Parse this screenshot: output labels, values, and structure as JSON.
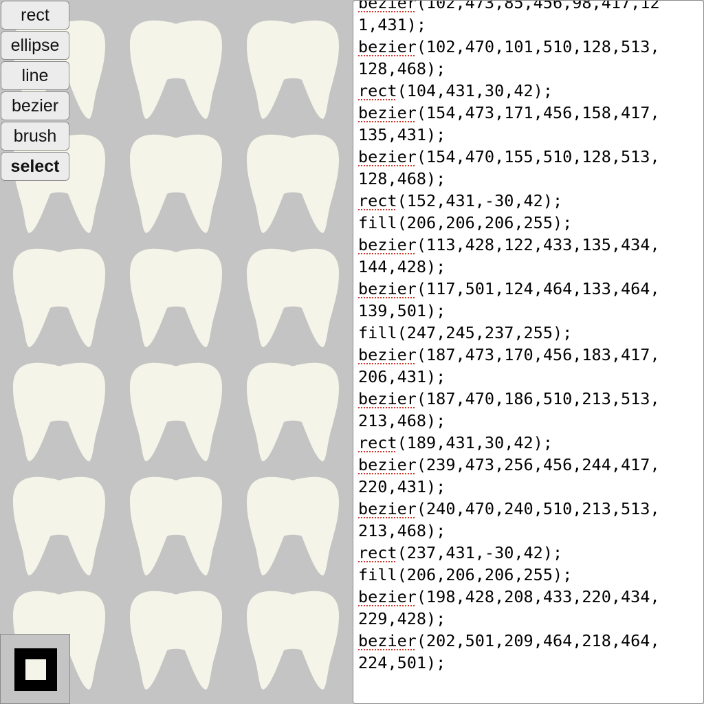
{
  "colors": {
    "canvas_bg": "#c4c4c4",
    "tooth_fill": "#f4f4e8",
    "tooth_gap": "#cecece",
    "panel_bg": "#ffffff",
    "spell_underline": "#d0342c"
  },
  "tools": [
    {
      "label": "rect",
      "active": false
    },
    {
      "label": "ellipse",
      "active": false
    },
    {
      "label": "line",
      "active": false
    },
    {
      "label": "bezier",
      "active": false
    },
    {
      "label": "brush",
      "active": false
    },
    {
      "label": "select",
      "active": true
    }
  ],
  "swatch": {
    "stroke_color": "#000000",
    "fill_color": "#f4f4e8"
  },
  "canvas": {
    "tooth_rows": 6,
    "tooth_cols": 3
  },
  "code": {
    "lines": [
      {
        "fn": "bezier",
        "rest": "(102,473,85,456,98,417,12"
      },
      {
        "fn": "",
        "rest": "1,431);"
      },
      {
        "fn": "bezier",
        "rest": "(102,470,101,510,128,513,"
      },
      {
        "fn": "",
        "rest": "128,468);"
      },
      {
        "fn": "rect",
        "rest": "(104,431,30,42);"
      },
      {
        "fn": "bezier",
        "rest": "(154,473,171,456,158,417,"
      },
      {
        "fn": "",
        "rest": "135,431);"
      },
      {
        "fn": "bezier",
        "rest": "(154,470,155,510,128,513,"
      },
      {
        "fn": "",
        "rest": "128,468);"
      },
      {
        "fn": "rect",
        "rest": "(152,431,-30,42);"
      },
      {
        "fn": "",
        "rest": "fill(206,206,206,255);"
      },
      {
        "fn": "bezier",
        "rest": "(113,428,122,433,135,434,"
      },
      {
        "fn": "",
        "rest": "144,428);"
      },
      {
        "fn": "bezier",
        "rest": "(117,501,124,464,133,464,"
      },
      {
        "fn": "",
        "rest": "139,501);"
      },
      {
        "fn": "",
        "rest": "fill(247,245,237,255);"
      },
      {
        "fn": "bezier",
        "rest": "(187,473,170,456,183,417,"
      },
      {
        "fn": "",
        "rest": "206,431);"
      },
      {
        "fn": "bezier",
        "rest": "(187,470,186,510,213,513,"
      },
      {
        "fn": "",
        "rest": "213,468);"
      },
      {
        "fn": "rect",
        "rest": "(189,431,30,42);"
      },
      {
        "fn": "bezier",
        "rest": "(239,473,256,456,244,417,"
      },
      {
        "fn": "",
        "rest": "220,431);"
      },
      {
        "fn": "bezier",
        "rest": "(240,470,240,510,213,513,"
      },
      {
        "fn": "",
        "rest": "213,468);"
      },
      {
        "fn": "rect",
        "rest": "(237,431,-30,42);"
      },
      {
        "fn": "",
        "rest": "fill(206,206,206,255);"
      },
      {
        "fn": "bezier",
        "rest": "(198,428,208,433,220,434,"
      },
      {
        "fn": "",
        "rest": "229,428);"
      },
      {
        "fn": "bezier",
        "rest": "(202,501,209,464,218,464,"
      },
      {
        "fn": "",
        "rest": "224,501);"
      }
    ]
  }
}
